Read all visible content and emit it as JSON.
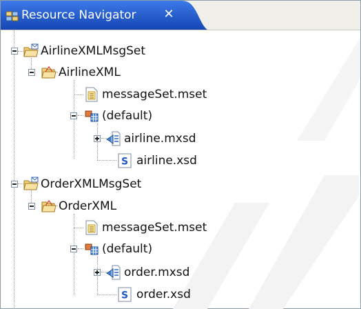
{
  "view": {
    "title": "Resource Navigator",
    "close_label": "✕",
    "tab_icon": "resource-navigator-icon"
  },
  "tree": {
    "airline_project": {
      "label": "AirlineXMLMsgSet",
      "icon": "message-set-project-icon",
      "expanded": true,
      "message_set": {
        "label": "AirlineXML",
        "icon": "message-set-folder-icon",
        "expanded": true,
        "mset_file": {
          "label": "messageSet.mset",
          "icon": "mset-file-icon"
        },
        "namespace": {
          "label": "(default)",
          "icon": "namespace-icon",
          "expanded": true,
          "mxsd_file": {
            "label": "airline.mxsd",
            "icon": "mxsd-file-icon",
            "expanded": false
          },
          "xsd_file": {
            "label": "airline.xsd",
            "icon": "xsd-file-icon"
          }
        }
      }
    },
    "order_project": {
      "label": "OrderXMLMsgSet",
      "icon": "message-set-project-icon",
      "expanded": true,
      "message_set": {
        "label": "OrderXML",
        "icon": "message-set-folder-icon",
        "expanded": true,
        "mset_file": {
          "label": "messageSet.mset",
          "icon": "mset-file-icon"
        },
        "namespace": {
          "label": "(default)",
          "icon": "namespace-icon",
          "expanded": true,
          "mxsd_file": {
            "label": "order.mxsd",
            "icon": "mxsd-file-icon",
            "expanded": false
          },
          "xsd_file": {
            "label": "order.xsd",
            "icon": "xsd-file-icon"
          }
        }
      }
    }
  },
  "colors": {
    "tab_active": "#1c57c7",
    "tab_text": "#ffffff",
    "tree_lines": "#9a9a9a",
    "folder": "#e8b94a",
    "file_blue": "#2a62c9"
  }
}
